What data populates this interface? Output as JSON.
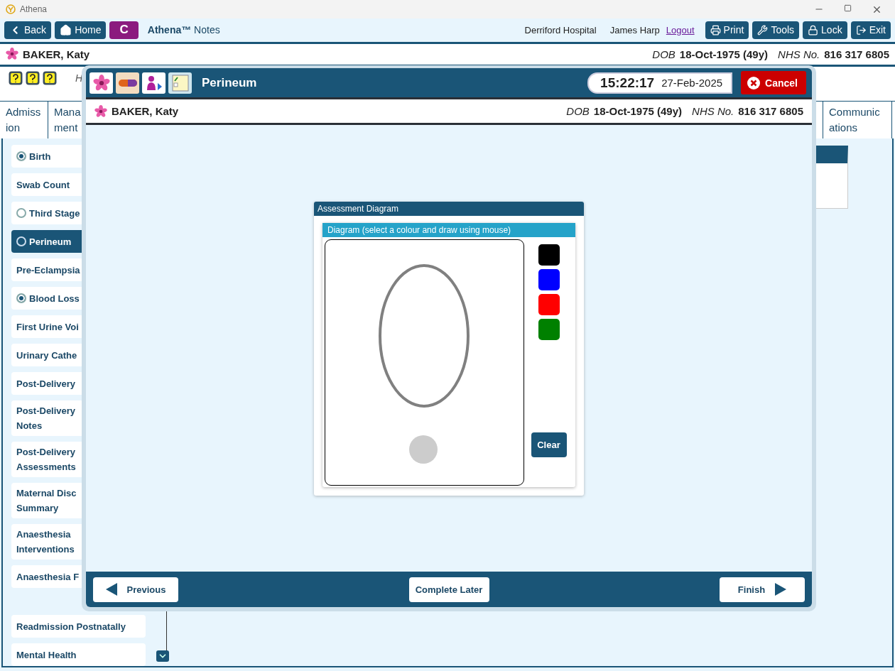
{
  "window": {
    "title": "Athena"
  },
  "toolbar": {
    "left_buttons": [
      {
        "kind": "back",
        "label": "Back"
      },
      {
        "kind": "home",
        "label": "Home"
      },
      {
        "kind": "letter",
        "label": "C"
      }
    ],
    "app_name": "**Athena™** Notes",
    "hospital": "Derriford Hospital",
    "user": "James Harp",
    "logout": "Logout",
    "right_buttons": [
      {
        "kind": "print",
        "label": "Print"
      },
      {
        "kind": "tools",
        "label": "Tools"
      },
      {
        "kind": "lock",
        "label": "Lock"
      },
      {
        "kind": "exit",
        "label": "Exit"
      }
    ]
  },
  "patient_banner": {
    "name": "BAKER, Katy",
    "dob_label": "DOB",
    "dob": "18-Oct-1975 (49y)",
    "nhs_label": "NHS No.",
    "nhs": "816 317 6805"
  },
  "header_text": "H",
  "tabs": [
    {
      "label": "Admission",
      "selected": false
    },
    {
      "label": "Mana ment",
      "selected": false
    },
    {
      "label": "Communications",
      "selected": false
    }
  ],
  "sidebar": {
    "groups": [
      [
        {
          "label": "Birth",
          "kind": "radio",
          "checked": true,
          "selected": false
        },
        {
          "label": "Swab Count",
          "kind": "plain",
          "selected": false
        },
        {
          "label": "Third Stage",
          "kind": "radio",
          "checked": false,
          "selected": false
        },
        {
          "label": "Perineum",
          "kind": "radio",
          "checked": false,
          "selected": true
        },
        {
          "label": "Pre-Eclampsia",
          "kind": "plain",
          "selected": false
        },
        {
          "label": "Blood Loss",
          "kind": "radio",
          "checked": true,
          "selected": false
        },
        {
          "label": "First Urine Voi",
          "kind": "plain",
          "selected": false
        },
        {
          "label": "Urinary Cathe",
          "kind": "plain",
          "selected": false
        },
        {
          "label": "Post-Delivery",
          "kind": "plain",
          "selected": false
        },
        {
          "label": "Post-Delivery\nNotes",
          "kind": "plain",
          "selected": false
        },
        {
          "label": "Post-Delivery\nAssessments",
          "kind": "plain",
          "selected": false
        },
        {
          "label": "Maternal Disc\nSummary",
          "kind": "plain",
          "selected": false
        },
        {
          "label": "Anaesthesia\nInterventions",
          "kind": "plain",
          "selected": false
        },
        {
          "label": "Anaesthesia F",
          "kind": "plain",
          "selected": false
        }
      ],
      [
        {
          "label": "Readmission Postnatally",
          "kind": "plain",
          "selected": false
        },
        {
          "label": "Mental Health",
          "kind": "plain",
          "selected": false
        }
      ]
    ]
  },
  "dialog": {
    "title": "Perineum",
    "time": "15:22:17",
    "date": "27-Feb-2025",
    "cancel": "Cancel",
    "patient": {
      "name": "BAKER, Katy",
      "dob_label": "DOB",
      "dob": "18-Oct-1975 (49y)",
      "nhs_label": "NHS No.",
      "nhs": "816 317 6805"
    },
    "panel": {
      "title": "Assessment Diagram",
      "diagram_title": "Diagram (select a colour and draw using mouse)",
      "colors": [
        {
          "color": "#000000"
        },
        {
          "color": "#0000ff"
        },
        {
          "color": "#ff0000"
        },
        {
          "color": "#008000"
        }
      ],
      "clear": "Clear"
    },
    "footer": {
      "previous": "Previous",
      "complete_later": "Complete Later",
      "finish": "Finish"
    }
  }
}
